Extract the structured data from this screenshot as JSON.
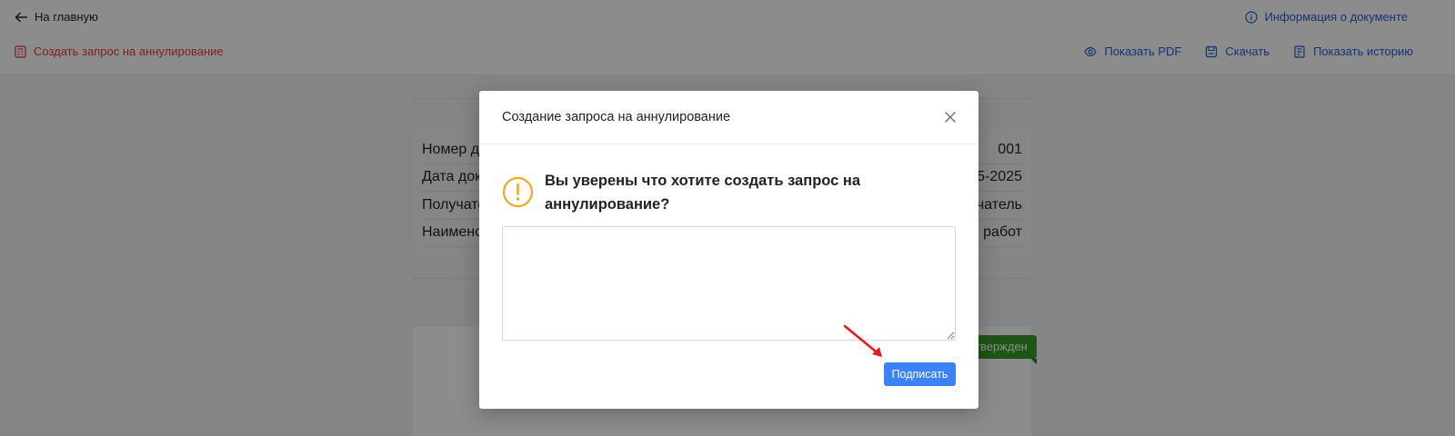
{
  "header": {
    "back_label": "На главную",
    "info_label": "Информация о документе",
    "annul_label": "Создать запрос на аннулирование",
    "toolbar": [
      {
        "label": "Показать PDF",
        "icon": "eye-icon"
      },
      {
        "label": "Скачать",
        "icon": "save-icon"
      },
      {
        "label": "Показать историю",
        "icon": "history-icon"
      }
    ]
  },
  "background": {
    "rows": [
      {
        "label": "Номер до",
        "value": "001"
      },
      {
        "label": "Дата док",
        "value": "5-2025"
      },
      {
        "label": "Получате",
        "value": "чатель"
      },
      {
        "label": "Наимено",
        "value": "работ"
      }
    ],
    "status": "твержден"
  },
  "modal": {
    "title": "Создание запроса на аннулирование",
    "question": "Вы уверены что хотите создать запрос на аннулирование?",
    "comment_value": "",
    "sign_label": "Подписать"
  },
  "colors": {
    "accent": "#3b82f6",
    "link": "#1f5fd6",
    "danger": "#e23b3b",
    "warning": "#f0a820",
    "status_green": "#3a9a2a"
  }
}
